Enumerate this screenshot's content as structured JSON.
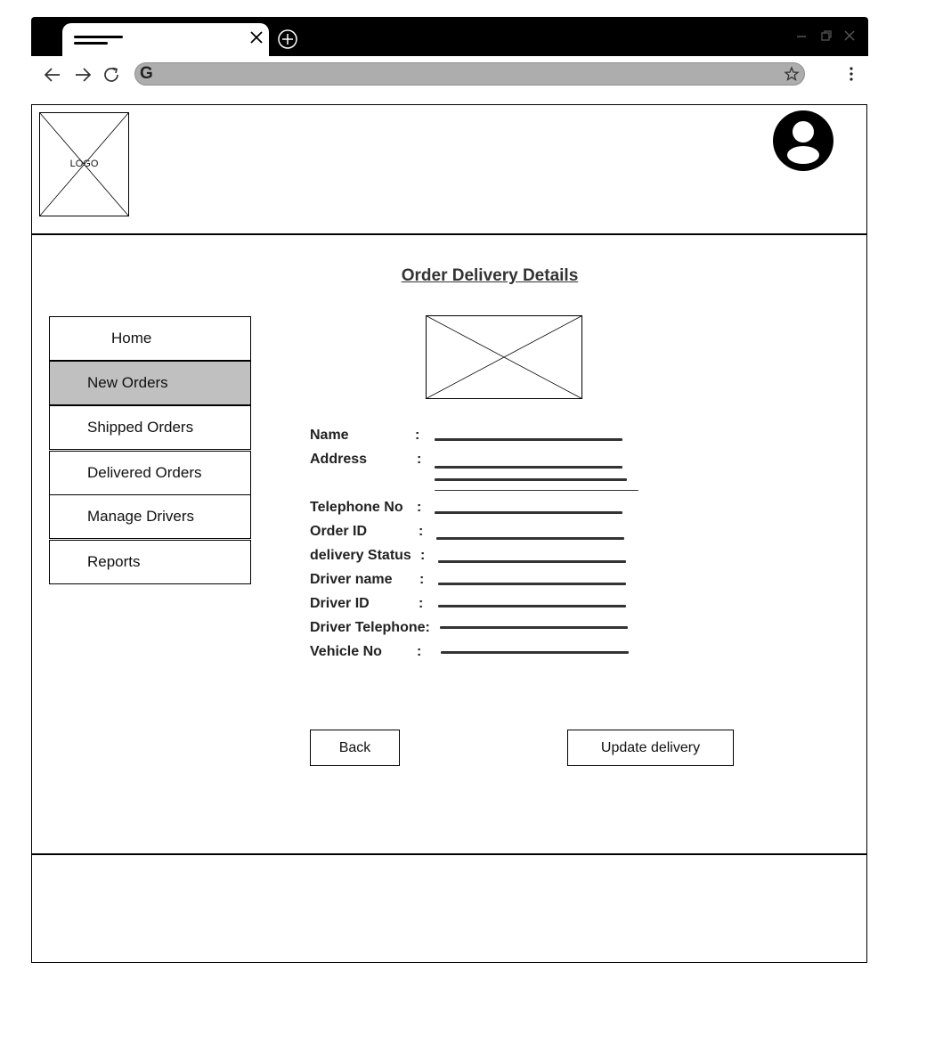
{
  "page": {
    "logo_text": "LOGO",
    "title": "Order Delivery Details"
  },
  "sidebar": {
    "items": [
      {
        "label": "Home",
        "active": false
      },
      {
        "label": "New Orders",
        "active": true
      },
      {
        "label": "Shipped Orders",
        "active": false
      },
      {
        "label": "Delivered Orders",
        "active": false
      },
      {
        "label": "Manage Drivers",
        "active": false
      },
      {
        "label": "Reports",
        "active": false
      }
    ]
  },
  "form": {
    "fields": [
      {
        "label": "Name",
        "colon": ":"
      },
      {
        "label": "Address",
        "colon": ":"
      },
      {
        "label": "Telephone No",
        "colon": ":"
      },
      {
        "label": "Order ID",
        "colon": ":"
      },
      {
        "label": "delivery Status",
        "colon": ":"
      },
      {
        "label": "Driver name",
        "colon": ":"
      },
      {
        "label": "Driver ID",
        "colon": ":"
      },
      {
        "label": "Driver Telephone:",
        "colon": ""
      },
      {
        "label": "Vehicle No",
        "colon": ":"
      }
    ]
  },
  "buttons": {
    "back": "Back",
    "update": "Update delivery"
  },
  "icons": {
    "browser": [
      "tab-close-icon",
      "new-tab-icon",
      "minimize-icon",
      "restore-icon",
      "window-close-icon",
      "back-arrow-icon",
      "forward-arrow-icon",
      "reload-icon",
      "google-icon",
      "star-icon",
      "menu-icon"
    ],
    "page": [
      "logo-placeholder-icon",
      "user-avatar-icon",
      "image-placeholder-icon"
    ]
  },
  "colors": {
    "chrome": "#000000",
    "omnibox": "#adadad",
    "active_nav": "#c0c0c0"
  }
}
